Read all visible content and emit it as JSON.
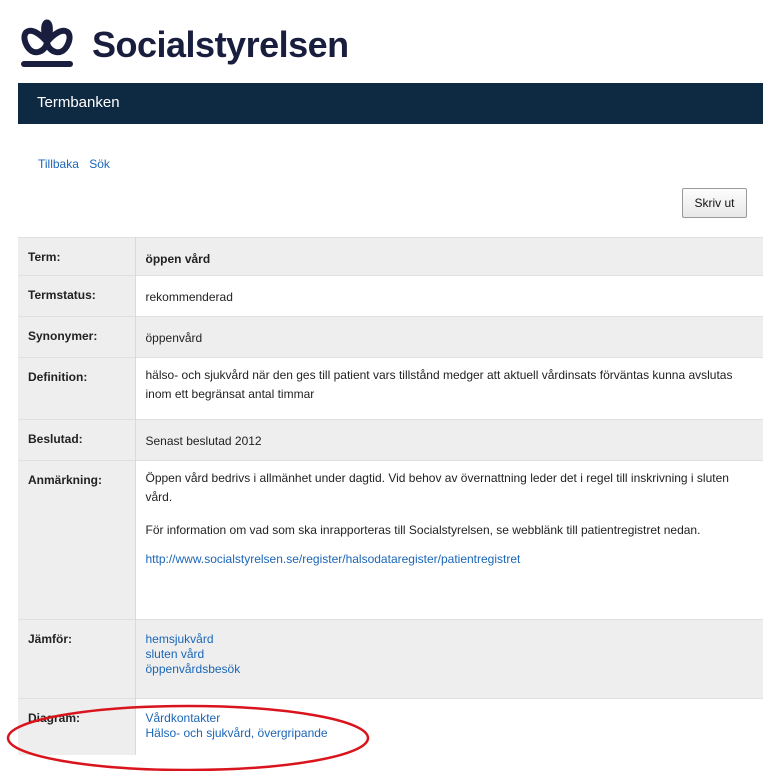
{
  "header": {
    "org_name": "Socialstyrelsen",
    "app_title": "Termbanken"
  },
  "nav": {
    "back_label": "Tillbaka",
    "search_label": "Sök",
    "print_label": "Skriv ut"
  },
  "term": {
    "term_label": "Term:",
    "term_value": "öppen vård",
    "status_label": "Termstatus:",
    "status_value": "rekommenderad",
    "synonyms_label": "Synonymer:",
    "synonyms_value": "öppenvård",
    "definition_label": "Definition:",
    "definition_value": "hälso- och sjukvård när den ges till patient vars tillstånd medger att aktuell vårdinsats förväntas kunna avslutas inom ett begränsat antal timmar",
    "decided_label": "Beslutad:",
    "decided_value": "Senast beslutad 2012",
    "remark_label": "Anmärkning:",
    "remark_p1": "Öppen vård bedrivs i allmänhet under dagtid. Vid behov av övernattning leder det i regel till inskrivning i sluten vård.",
    "remark_p2": "För information om vad som ska inrapporteras till Socialstyrelsen, se webblänk till patientregistret nedan.",
    "remark_link": "http://www.socialstyrelsen.se/register/halsodataregister/patientregistret",
    "compare_label": "Jämför:",
    "compare_links": [
      "hemsjukvård",
      "sluten vård",
      "öppenvårdsbesök"
    ],
    "diagram_label": "Diagram:",
    "diagram_links": [
      "Vårdkontakter",
      "Hälso- och sjukvård, övergripande"
    ]
  },
  "colors": {
    "header_bar": "#0e2a43",
    "link": "#1a66b8",
    "label_bg": "#eeeeee",
    "annotation_circle": "#d9141c"
  },
  "icons": {
    "logo": "socialstyrelsen-logo-icon"
  }
}
